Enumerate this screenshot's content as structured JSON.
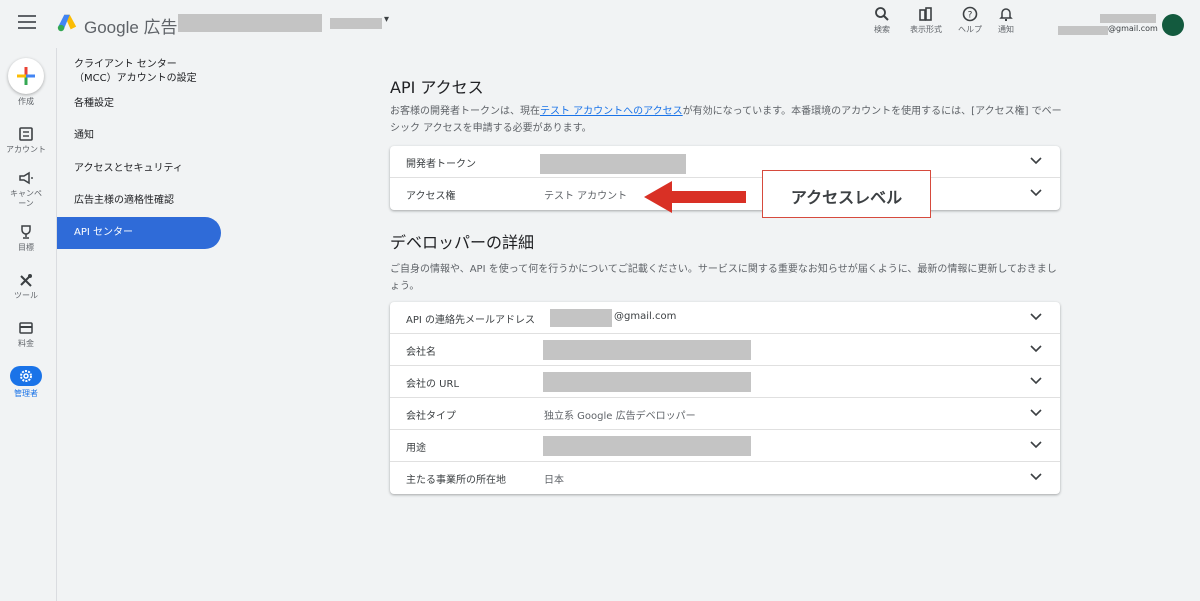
{
  "header": {
    "brand": "Google 広告",
    "account_caret": "▾",
    "tools": [
      {
        "icon": "search-icon",
        "label": "検索"
      },
      {
        "icon": "appearance-icon",
        "label": "表示形式"
      },
      {
        "icon": "help-icon",
        "label": "ヘルプ"
      },
      {
        "icon": "bell-icon",
        "label": "通知"
      }
    ],
    "user_email_suffix": "@gmail.com"
  },
  "rail": {
    "create_label": "作成",
    "items": [
      {
        "icon": "account-icon",
        "label": "アカウント"
      },
      {
        "icon": "megaphone-icon",
        "label": "キャンペーン"
      },
      {
        "icon": "trophy-icon",
        "label": "目標"
      },
      {
        "icon": "tools-icon",
        "label": "ツール"
      },
      {
        "icon": "billing-icon",
        "label": "料金"
      },
      {
        "icon": "gear-icon",
        "label": "管理者"
      }
    ]
  },
  "sidebar": {
    "items": [
      {
        "label": "クライアント センター\n（MCC）アカウントの設定"
      },
      {
        "label": "各種設定"
      },
      {
        "label": "通知"
      },
      {
        "label": "アクセスとセキュリティ"
      },
      {
        "label": "広告主様の適格性確認"
      },
      {
        "label": "API センター"
      }
    ]
  },
  "api_access": {
    "title": "API アクセス",
    "desc_before": "お客様の開発者トークンは、現在",
    "desc_link": "テスト アカウントへのアクセス",
    "desc_after": "が有効になっています。本番環境のアカウントを使用するには、[アクセス権] でベーシック アクセスを申請する必要があります。",
    "rows": [
      {
        "label": "開発者トークン",
        "value": ""
      },
      {
        "label": "アクセス権",
        "value": "テスト アカウント"
      }
    ],
    "annotation": "アクセスレベル"
  },
  "developer": {
    "title": "デベロッパーの詳細",
    "desc": "ご自身の情報や、API を使って何を行うかについてご記載ください。サービスに関する重要なお知らせが届くように、最新の情報に更新しておきましょう。",
    "rows": [
      {
        "label": "API の連絡先メールアドレス",
        "value": "@gmail.com"
      },
      {
        "label": "会社名",
        "value": ""
      },
      {
        "label": "会社の URL",
        "value": ""
      },
      {
        "label": "会社タイプ",
        "value": "独立系 Google 広告デベロッパー"
      },
      {
        "label": "用途",
        "value": ""
      },
      {
        "label": "主たる事業所の所在地",
        "value": "日本"
      }
    ]
  },
  "colors": {
    "accent": "#1a73e8",
    "active_nav": "#2f6bd8",
    "arrow": "#d93025",
    "avatar": "#135a3e"
  }
}
